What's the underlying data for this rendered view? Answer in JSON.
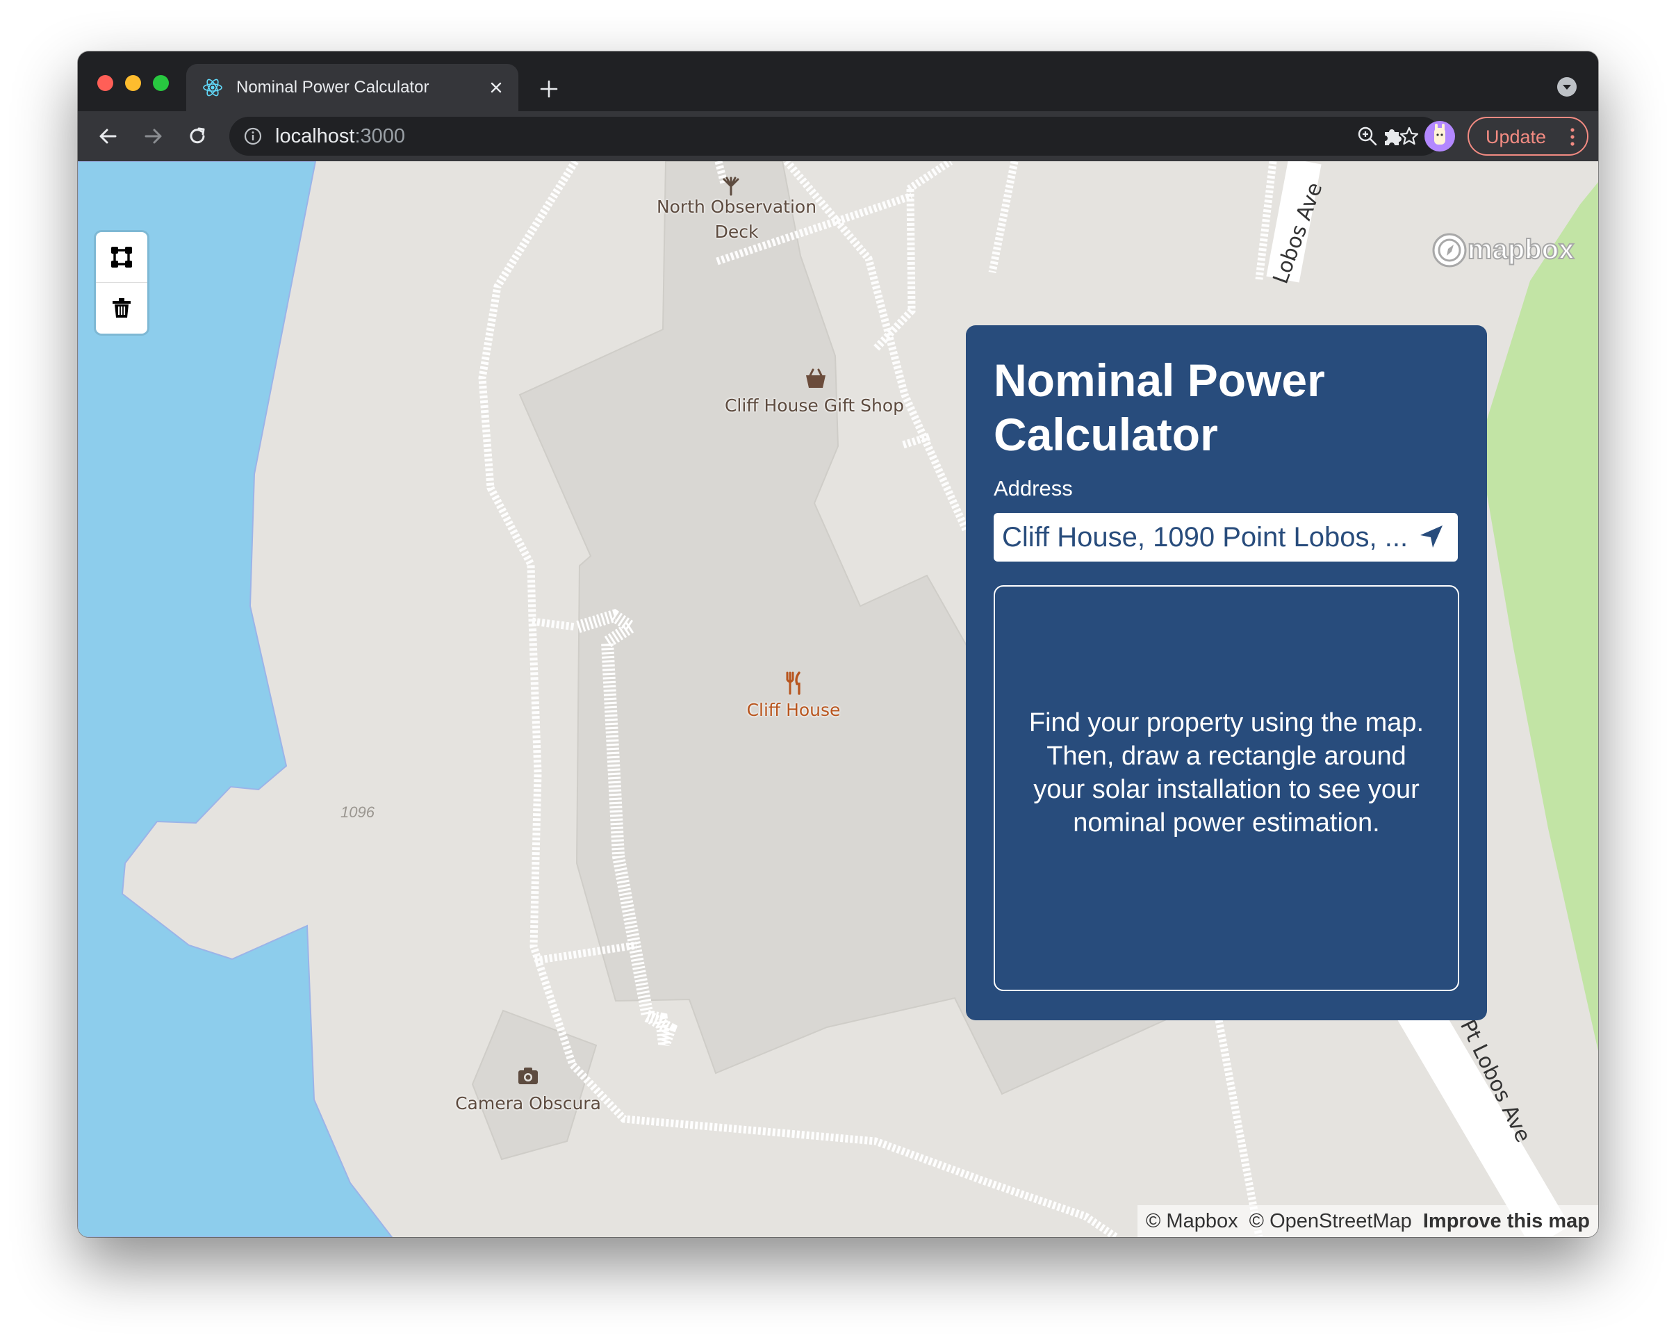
{
  "browser": {
    "tab_title": "Nominal Power Calculator",
    "url_host": "localhost",
    "url_port": ":3000",
    "update_label": "Update"
  },
  "map": {
    "places": {
      "north_observation_line1": "North Observation",
      "north_observation_line2": "Deck",
      "gift_shop": "Cliff House Gift Shop",
      "restaurant": "Cliff House",
      "camera_obscura": "Camera Obscura"
    },
    "elevation": "1096",
    "roads": {
      "upper": "Lobos Ave",
      "lower": "Pt Lobos Ave"
    },
    "logo": "mapbox",
    "attribution": {
      "mapbox": "© Mapbox",
      "osm": "© OpenStreetMap",
      "improve": "Improve this map"
    },
    "colors": {
      "water": "#8dcdec",
      "land": "#e5e3df",
      "park": "#c2e4a5",
      "building": "#d9d7d3"
    }
  },
  "panel": {
    "title": "Nominal Power Calculator",
    "address_label": "Address",
    "address_value": "Cliff House, 1090 Point Lobos, ...",
    "message": "Find your property using the map. Then, draw a rectangle around your solar installation to see your nominal power estimation.",
    "background": "#284c7c"
  }
}
